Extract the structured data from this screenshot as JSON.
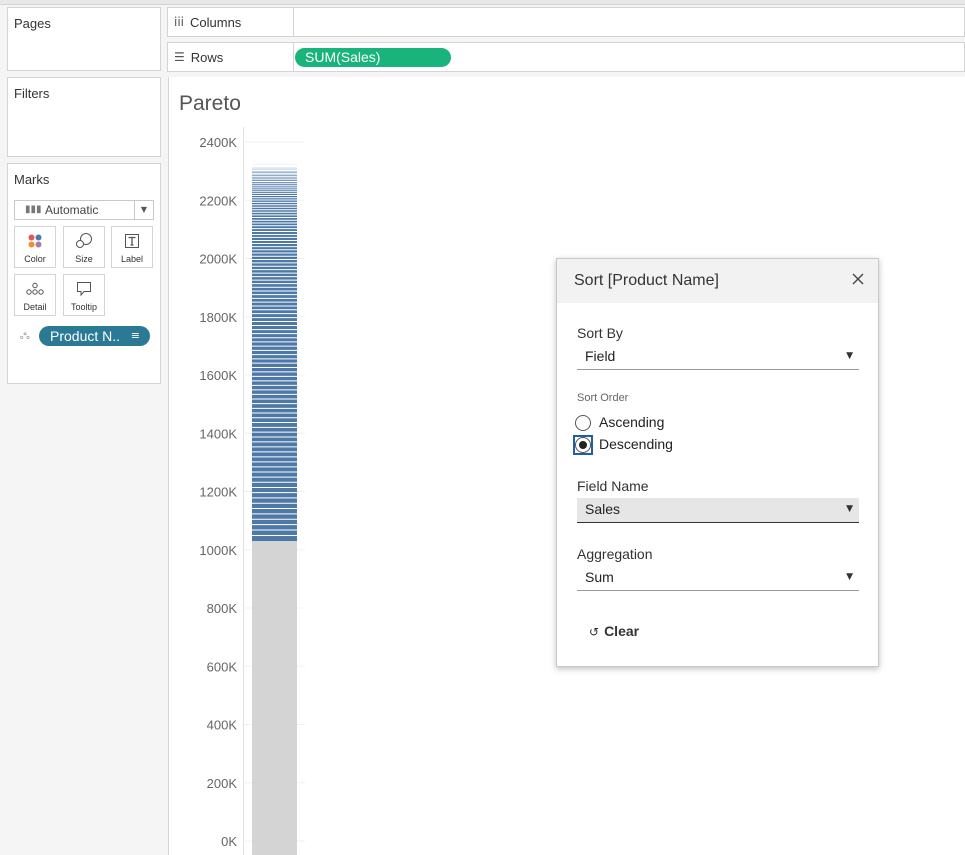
{
  "shelves": {
    "pages_title": "Pages",
    "filters_title": "Filters",
    "columns_label": "Columns",
    "rows_label": "Rows",
    "rows_pill": "SUM(Sales)"
  },
  "marks": {
    "title": "Marks",
    "mark_type": "Automatic",
    "buttons": {
      "color": "Color",
      "size": "Size",
      "label": "Label",
      "detail": "Detail",
      "tooltip": "Tooltip"
    },
    "detail_pill": "Product N.."
  },
  "view": {
    "title": "Pareto"
  },
  "chart_data": {
    "type": "bar",
    "title": "Pareto",
    "xlabel": "",
    "ylabel": "",
    "ylim": [
      0,
      2420000
    ],
    "y_ticks": [
      0,
      200000,
      400000,
      600000,
      800000,
      1000000,
      1200000,
      1400000,
      1600000,
      1800000,
      2000000,
      2200000,
      2400000
    ],
    "y_tick_labels": [
      "0K",
      "200K",
      "400K",
      "600K",
      "800K",
      "1000K",
      "1200K",
      "1400K",
      "1600K",
      "1800K",
      "2000K",
      "2200K",
      "2400K"
    ],
    "categories": [
      ""
    ],
    "values": [
      2330000
    ],
    "highlighted_from": 1030000,
    "bar_color": "#4e79a7",
    "dimmed_color": "#d4d4d4",
    "grid": false
  },
  "sort_dialog": {
    "title": "Sort [Product Name]",
    "sort_by_label": "Sort By",
    "sort_by_value": "Field",
    "sort_order_label": "Sort Order",
    "ascending": "Ascending",
    "descending": "Descending",
    "selected_order": "descending",
    "field_name_label": "Field Name",
    "field_name_value": "Sales",
    "aggregation_label": "Aggregation",
    "aggregation_value": "Sum",
    "clear_label": "Clear"
  },
  "colors": {
    "rows_pill": "#18b47b",
    "detail_pill": "#2b7a95",
    "bar": "#4e79a7"
  }
}
